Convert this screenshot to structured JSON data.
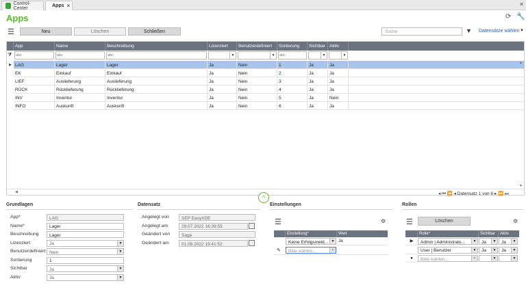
{
  "tabs": [
    {
      "label": "Control-Center"
    },
    {
      "label": "Apps"
    }
  ],
  "title": "Apps",
  "toolbar": {
    "new": "Neu",
    "delete": "Löschen",
    "close": "Schließen",
    "search_placeholder": "Suche",
    "select_records": "Datensätze wählen"
  },
  "grid": {
    "columns": [
      "App",
      "Name",
      "Beschreibung",
      "Lizenziert",
      "Benutzerdefiniert",
      "Sortierung",
      "Sichtbar",
      "Aktiv"
    ],
    "filter_placeholder": "abc",
    "rows": [
      [
        "LAG",
        "Lager",
        "Lager",
        "Ja",
        "Nein",
        "1",
        "Ja",
        "Ja"
      ],
      [
        "EK",
        "Einkauf",
        "Einkauf",
        "Ja",
        "Nein",
        "2",
        "Ja",
        "Ja"
      ],
      [
        "LIEF",
        "Auslieferung",
        "Auslieferung",
        "Ja",
        "Nein",
        "3",
        "Ja",
        "Ja"
      ],
      [
        "RÜCK",
        "Rücklieferung",
        "Rücklieferung",
        "Ja",
        "Nein",
        "4",
        "Ja",
        "Ja"
      ],
      [
        "INV",
        "Inventur",
        "Inventur",
        "Ja",
        "Nein",
        "5",
        "Ja",
        "Nein"
      ],
      [
        "INFO",
        "Auskunft",
        "Auskunft",
        "Ja",
        "Nein",
        "6",
        "Ja",
        "Ja"
      ]
    ],
    "pager": "Datensatz 1 von 6"
  },
  "grundlagen": {
    "title": "Grundlagen",
    "fields": [
      {
        "label": "App*",
        "value": "LAG"
      },
      {
        "label": "Name*",
        "value": "Lager"
      },
      {
        "label": "Beschreibung",
        "value": "Lager"
      },
      {
        "label": "Lizenziert",
        "value": "Ja"
      },
      {
        "label": "Benutzerdefiniert",
        "value": "Nein"
      },
      {
        "label": "Sortierung",
        "value": "1"
      },
      {
        "label": "Sichtbar",
        "value": "Ja"
      },
      {
        "label": "Aktiv",
        "value": "Ja"
      }
    ]
  },
  "datensatz": {
    "title": "Datensatz",
    "fields": [
      {
        "label": "Angelegt von",
        "value": "SEP EasyXDE"
      },
      {
        "label": "Angelegt am",
        "value": "29.07.2022 16:39:55"
      },
      {
        "label": "Geändert von",
        "value": "Sage"
      },
      {
        "label": "Geändert am",
        "value": "01.08.2022 19:41:52"
      }
    ]
  },
  "einstellungen": {
    "title": "Einstellungen",
    "columns": [
      "Einstellung*",
      "Wert"
    ],
    "row": {
      "setting": "Keine Erfolgsmeld...",
      "value": "Ja"
    },
    "new_placeholder": "Bitte wählen..."
  },
  "rollen": {
    "title": "Rollen",
    "delete": "Löschen",
    "columns": [
      "Rolle*",
      "Sichtbar",
      "Aktiv"
    ],
    "rows": [
      {
        "role": "Admin | Administrato...",
        "visible": "Ja",
        "active": "Ja"
      },
      {
        "role": "User | Benutzer",
        "visible": "Ja",
        "active": "Ja"
      }
    ],
    "new_placeholder": "Bitte wählen..."
  },
  "colors": {
    "accent": "#5db832",
    "header": "#6b7280",
    "selected": "#a9c4ec"
  }
}
